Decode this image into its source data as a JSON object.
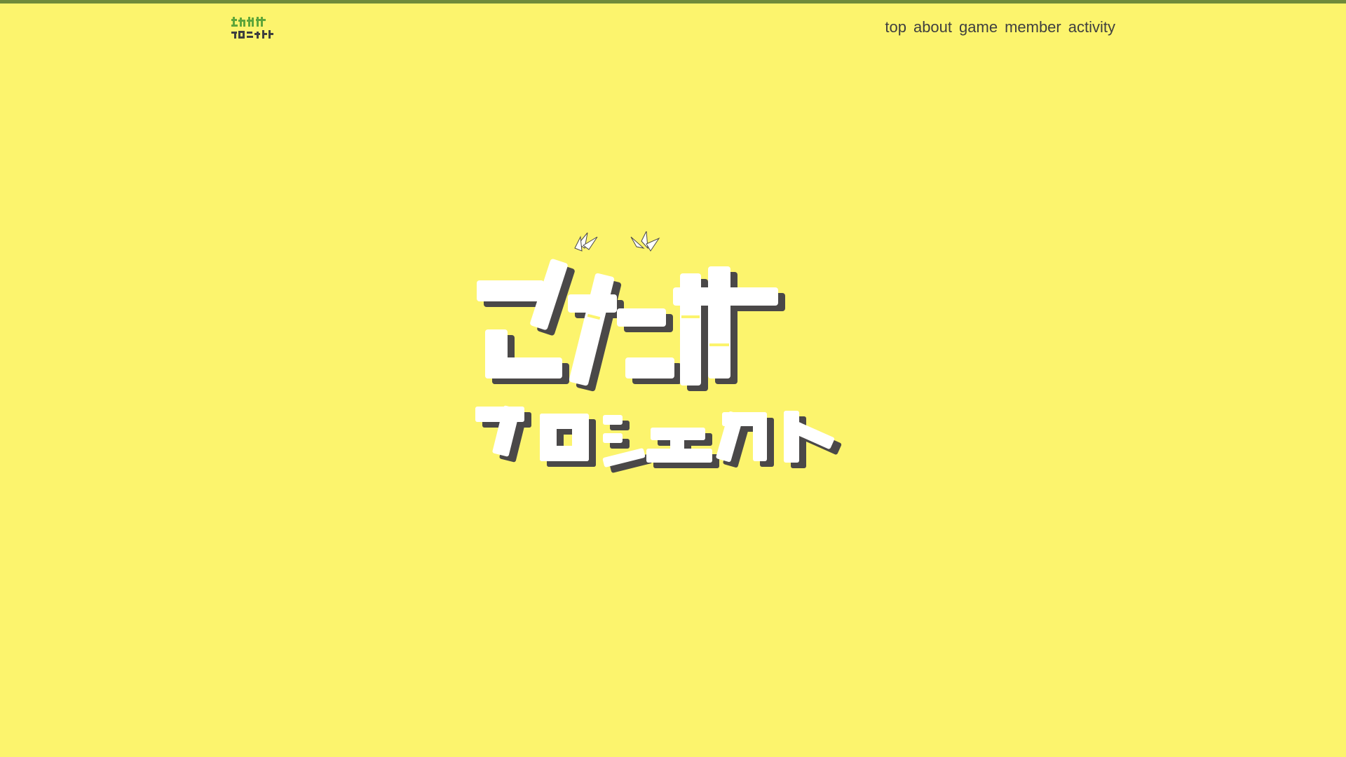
{
  "site": {
    "logo_text_top": "ささたけ",
    "logo_text_bottom": "プロジェクト",
    "logo_icon": "bamboo-logo-icon"
  },
  "nav": {
    "items": [
      "top",
      "about",
      "game",
      "member",
      "activity"
    ]
  },
  "hero": {
    "title_line1": "ささたけ",
    "title_line2": "プロジェクト",
    "decoration_icon": "bamboo-leaf-icon"
  },
  "colors": {
    "background": "#fcf46d",
    "stripe": "#6f8a3a",
    "nav_text": "#3f3f3f",
    "logo_green": "#5fa63a",
    "logo_dark": "#3f3f3f",
    "hero_fill": "#ffffff",
    "hero_shadow": "#4a4848"
  }
}
